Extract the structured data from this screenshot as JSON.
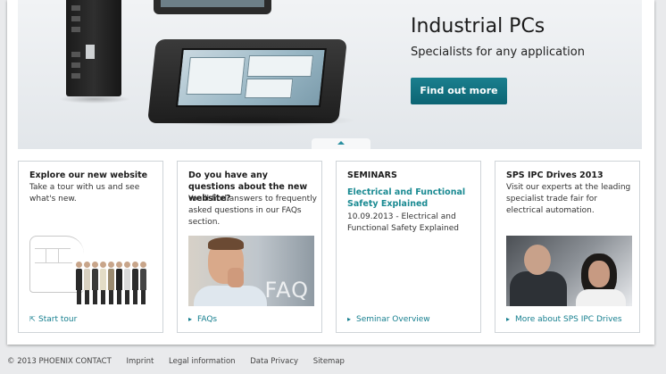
{
  "hero": {
    "title": "Industrial PCs",
    "subtitle": "Specialists for any application",
    "cta_label": "Find out more"
  },
  "cards": [
    {
      "title": "Explore our new website",
      "text": "Take a tour with us and see what's new.",
      "link": "Start tour",
      "link_icon": "external-link-icon"
    },
    {
      "title": "Do you have any questions about the new website?",
      "text": "You'll find answers to frequently asked questions in our FAQs section.",
      "link": "FAQs",
      "link_icon": "arrow-right-icon",
      "image_label": "FAQ"
    },
    {
      "title": "SEMINARS",
      "highlight": "Electrical and Functional Safety Explained",
      "text": "10.09.2013 - Electrical and Functional Safety Explained",
      "link": "Seminar Overview",
      "link_icon": "arrow-right-icon"
    },
    {
      "title": "SPS IPC Drives 2013",
      "text": "Visit our experts at the leading specialist trade fair for electrical automation.",
      "link": "More about SPS IPC Drives",
      "link_icon": "arrow-right-icon"
    }
  ],
  "footer": {
    "copyright": "© 2013 PHOENIX CONTACT",
    "links": [
      "Imprint",
      "Legal information",
      "Data Privacy",
      "Sitemap"
    ]
  },
  "colors": {
    "accent": "#167f8f",
    "cta_bg": "#0f6d7c",
    "page_bg": "#e9eaec"
  }
}
